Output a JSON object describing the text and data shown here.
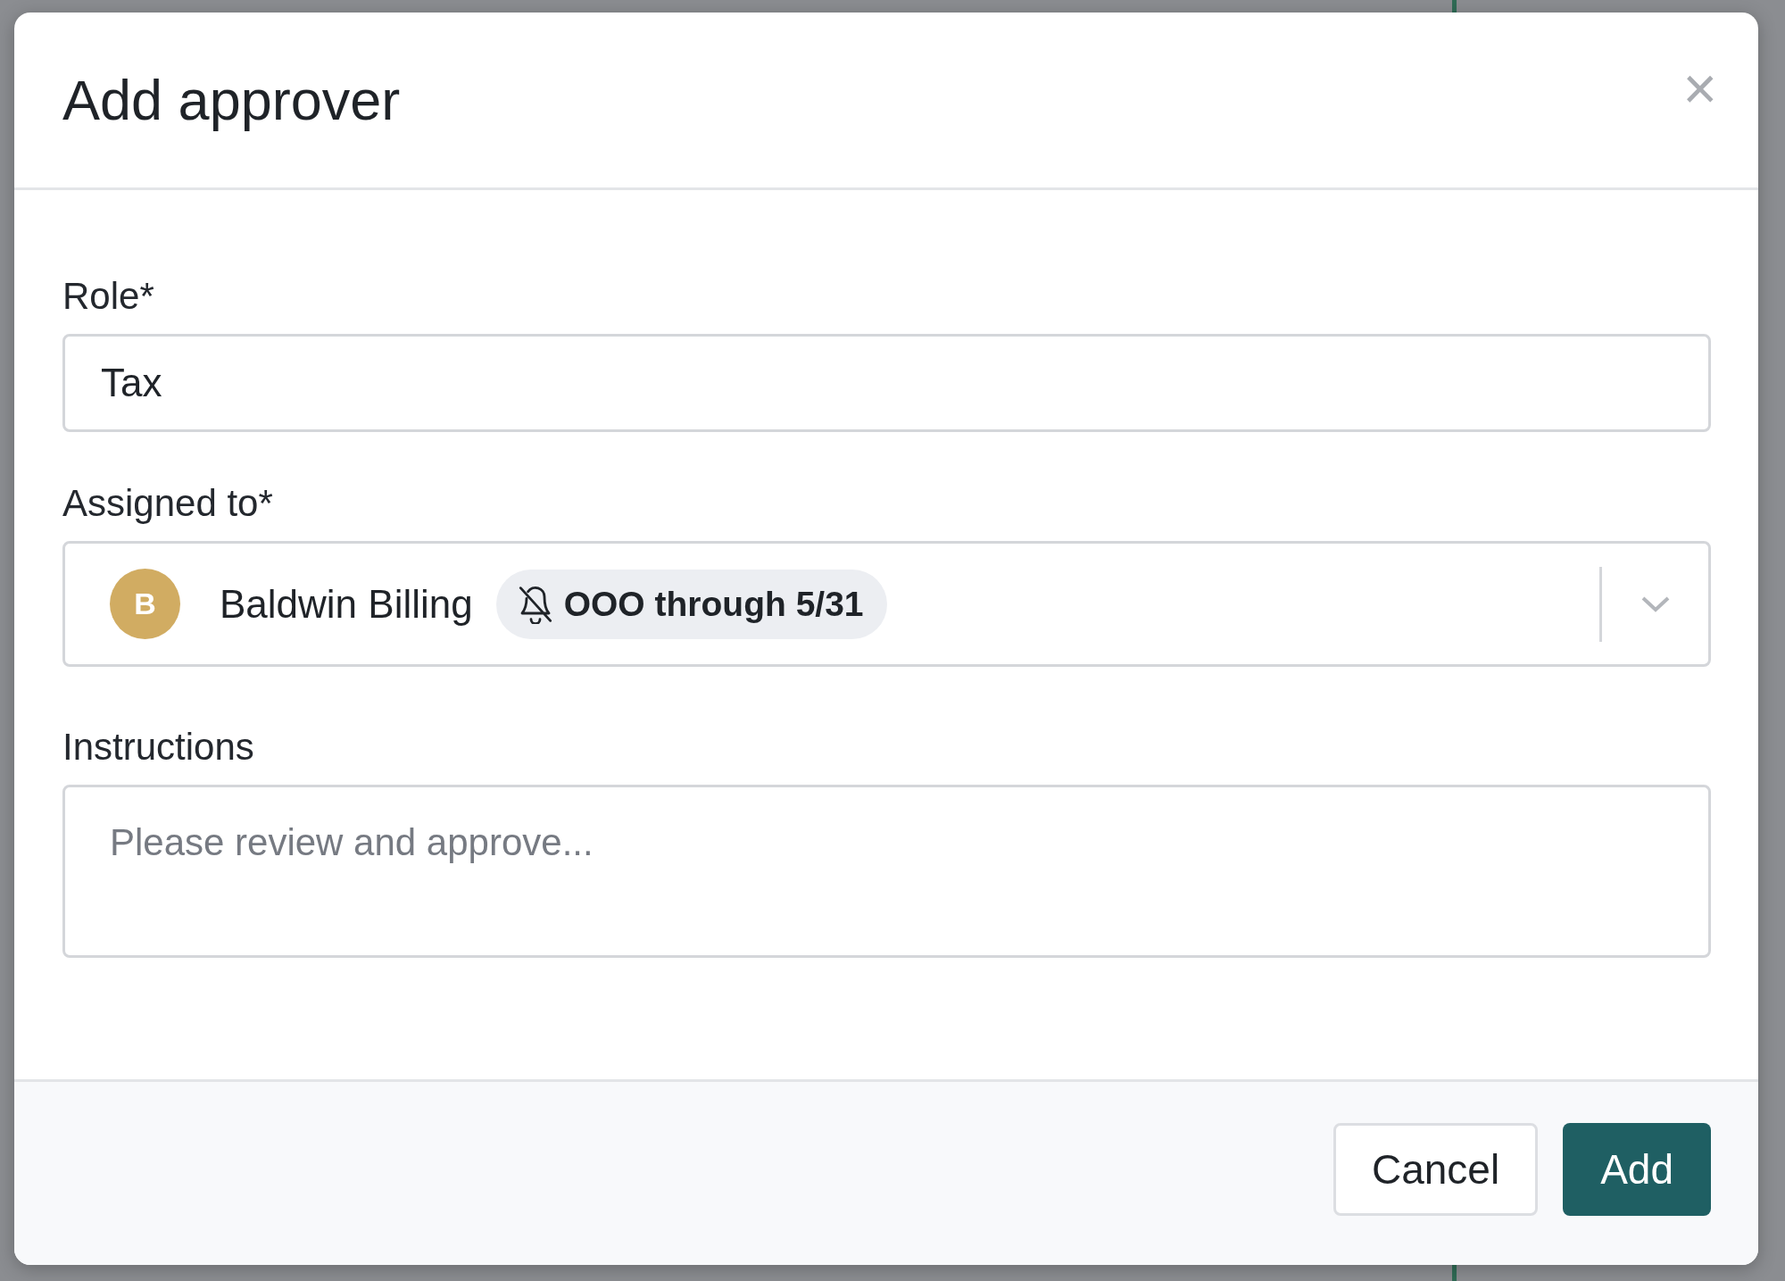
{
  "dialog": {
    "title": "Add approver",
    "close": "×",
    "fields": [
      {
        "kind": "text",
        "label": "Role*",
        "value": "Tax"
      },
      {
        "kind": "select",
        "label": "Assigned to*",
        "avatar": "B",
        "color": "#d1ac62",
        "value": "Baldwin Billing",
        "badge": "OOO through 5/31"
      },
      {
        "kind": "textarea",
        "label": "Instructions",
        "placeholder": "Please review and approve..."
      }
    ],
    "buttons": [
      {
        "label": "Cancel",
        "kind": "secondary"
      },
      {
        "label": "Add",
        "kind": "primary"
      }
    ]
  }
}
